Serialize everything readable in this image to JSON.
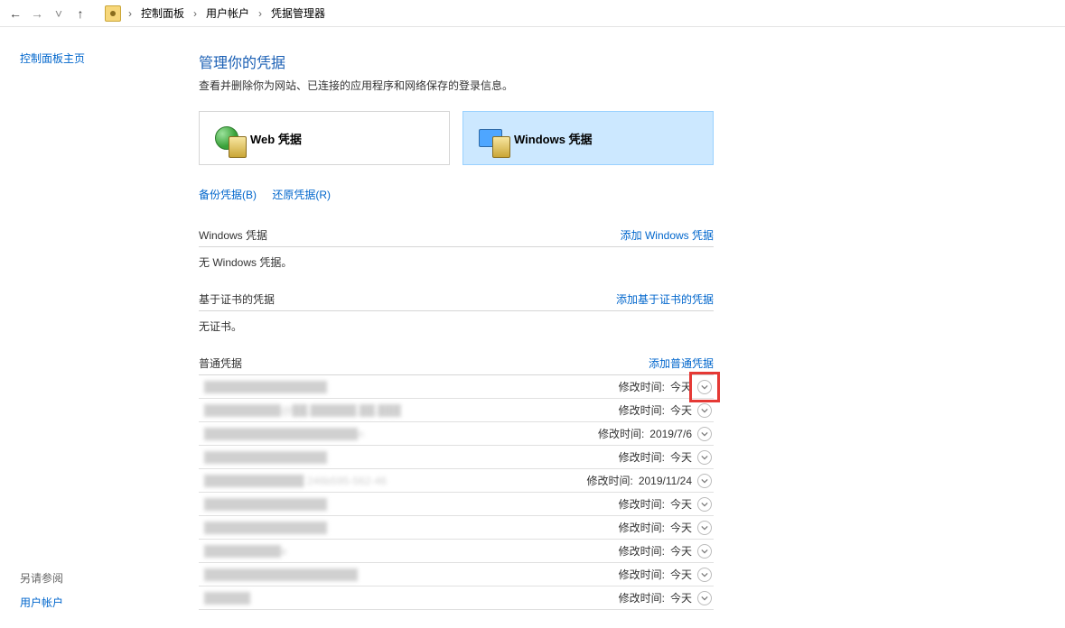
{
  "breadcrumb": {
    "parts": [
      "控制面板",
      "用户帐户",
      "凭据管理器"
    ]
  },
  "sidebar": {
    "home": "控制面板主页",
    "see_also_hdr": "另请参阅",
    "see_also_link": "用户帐户"
  },
  "page": {
    "title": "管理你的凭据",
    "subtitle": "查看并删除你为网站、已连接的应用程序和网络保存的登录信息。"
  },
  "tiles": {
    "web": "Web 凭据",
    "windows": "Windows 凭据"
  },
  "links": {
    "backup": "备份凭据(B)",
    "restore": "还原凭据(R)"
  },
  "sections": {
    "windows": {
      "title": "Windows 凭据",
      "add": "添加 Windows 凭据",
      "empty": "无 Windows 凭据。"
    },
    "cert": {
      "title": "基于证书的凭据",
      "add": "添加基于证书的凭据",
      "empty": "无证书。"
    },
    "generic": {
      "title": "普通凭据",
      "add": "添加普通凭据"
    }
  },
  "mod_label": "修改时间:",
  "credentials": [
    {
      "name": "████████████████",
      "date": "今天"
    },
    {
      "name": "██████████@██.██████.██.███",
      "date": "今天"
    },
    {
      "name": "████████████████████n",
      "date": "2019/7/6"
    },
    {
      "name": "████████████████",
      "date": "今天"
    },
    {
      "name": "█████████████ 246b595-562-46",
      "date": "2019/11/24"
    },
    {
      "name": "████████████████",
      "date": "今天"
    },
    {
      "name": "████████████████",
      "date": "今天"
    },
    {
      "name": "██████████e",
      "date": "今天"
    },
    {
      "name": "████████████████████",
      "date": "今天"
    },
    {
      "name": "██████",
      "date": "今天"
    }
  ]
}
